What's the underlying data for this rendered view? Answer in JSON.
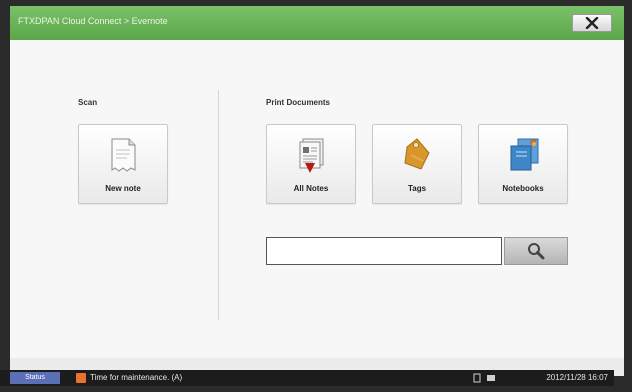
{
  "window": {
    "title": "FTXDPAN Cloud Connect > Evernote",
    "close_label": "✕"
  },
  "scan": {
    "label": "Scan",
    "tiles": [
      {
        "label": "New note",
        "icon": "document-icon"
      }
    ]
  },
  "print": {
    "label": "Print Documents",
    "tiles": [
      {
        "label": "All Notes",
        "icon": "notes-stack-icon"
      },
      {
        "label": "Tags",
        "icon": "tag-icon"
      },
      {
        "label": "Notebooks",
        "icon": "notebooks-icon"
      }
    ]
  },
  "search": {
    "value": "",
    "placeholder": "",
    "button_icon": "magnifier-icon"
  },
  "statusbar": {
    "tab_label": "Status",
    "message": "Time for maintenance. (A)",
    "time": "2012/11/28 16:07"
  },
  "colors": {
    "titlebar": "#5aa64a",
    "tag": "#d9962a",
    "status_tab": "#5a6fb8",
    "warning": "#e8722e"
  }
}
